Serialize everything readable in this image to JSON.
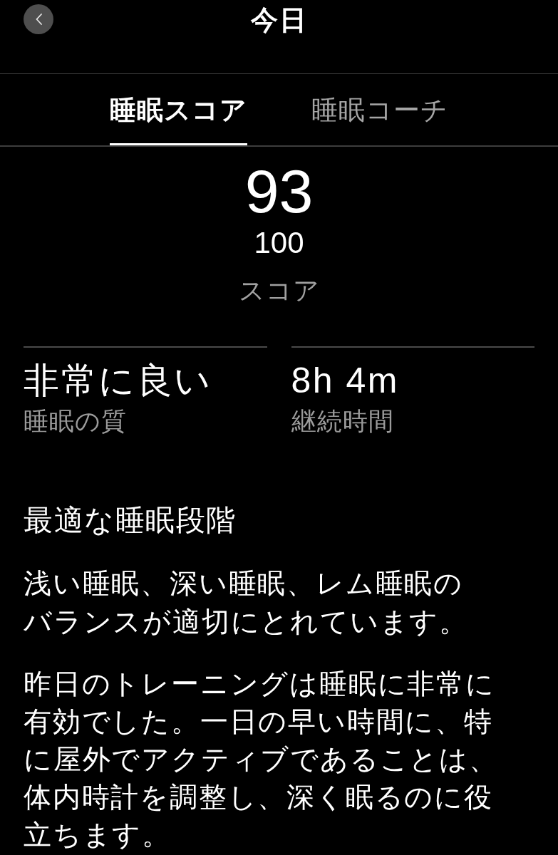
{
  "header": {
    "title": "今日"
  },
  "tabs": [
    {
      "label": "睡眠スコア",
      "selected": true
    },
    {
      "label": "睡眠コーチ",
      "selected": false
    }
  ],
  "score": {
    "value": "93",
    "max": "100",
    "label": "スコア"
  },
  "stats": [
    {
      "value": "非常に良い",
      "label": "睡眠の質"
    },
    {
      "value": "8h 4m",
      "label": "継続時間"
    }
  ],
  "section": {
    "title": "最適な睡眠段階",
    "paragraphs": [
      "浅い睡眠、深い睡眠、レム睡眠のバランスが適切にとれています。",
      "昨日のトレーニングは睡眠に非常に有効でした。一日の早い時間に、特に屋外でアクティブであることは、体内時計を調整し、深く眠るのに役立ちます。"
    ]
  }
}
